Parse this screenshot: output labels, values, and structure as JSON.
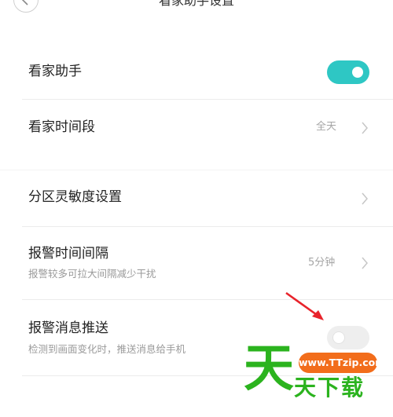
{
  "header": {
    "title": "看家助手设置"
  },
  "settings": {
    "guard_assistant": {
      "label": "看家助手",
      "enabled": true
    },
    "guard_period": {
      "label": "看家时间段",
      "value": "全天"
    },
    "zone_sensitivity": {
      "label": "分区灵敏度设置"
    },
    "alarm_interval": {
      "label": "报警时间间隔",
      "desc": "报警较多可拉大间隔减少干扰",
      "value": "5分钟"
    },
    "alarm_push": {
      "label": "报警消息推送",
      "desc": "检测到画面变化时，推送消息给手机",
      "enabled": false
    }
  },
  "watermark": {
    "big_char": "天",
    "url": "www.TTzip.com",
    "site_name": "天下载"
  },
  "colors": {
    "toggle_on": "#2ec7c4",
    "toggle_off": "#eeeeee",
    "annotation_arrow": "#e8232b",
    "watermark_green": "#2bb31e",
    "watermark_orange": "#f26d1b"
  }
}
